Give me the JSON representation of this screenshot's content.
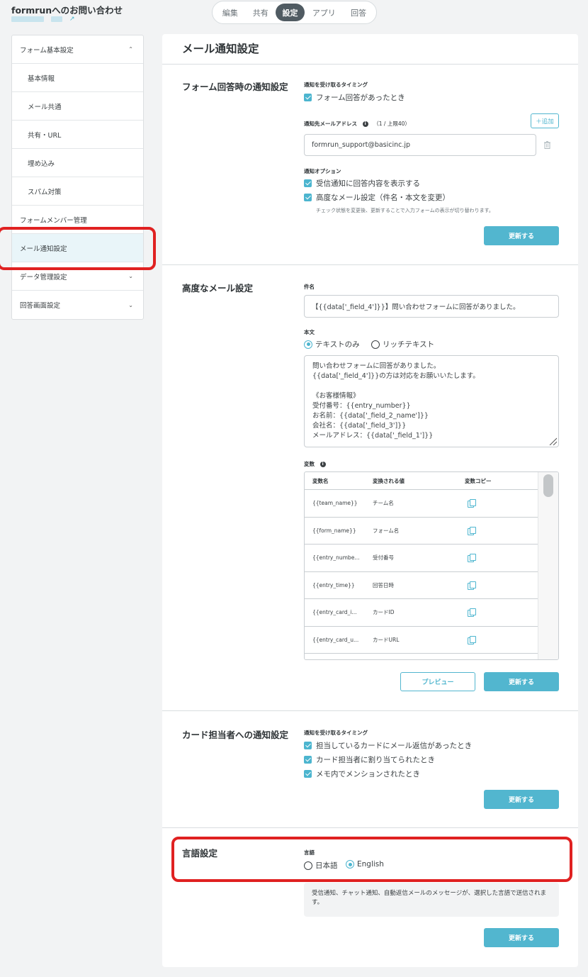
{
  "header": {
    "form_title": "formrunへのお問い合わせ"
  },
  "tabs": [
    "編集",
    "共有",
    "設定",
    "アプリ",
    "回答"
  ],
  "tabs_active": "設定",
  "sidebar": {
    "items": [
      {
        "label": "フォーム基本設定",
        "chevron": "⌃"
      },
      {
        "label": "基本情報"
      },
      {
        "label": "メール共通"
      },
      {
        "label": "共有・URL"
      },
      {
        "label": "埋め込み"
      },
      {
        "label": "スパム対策"
      },
      {
        "label": "フォームメンバー管理"
      },
      {
        "label": "メール通知設定"
      },
      {
        "label": "データ管理設定",
        "chevron": "⌄"
      },
      {
        "label": "回答画面設定",
        "chevron": "⌄"
      }
    ]
  },
  "main": {
    "page_title": "メール通知設定",
    "section1": {
      "title": "フォーム回答時の通知設定",
      "timing_label": "通知を受け取るタイミング",
      "timing_option": "フォーム回答があったとき",
      "address_label": "通知先メールアドレス",
      "address_limit": "（1 / 上限40）",
      "add_button": "＋追加",
      "email_value": "formrun_support@basicinc.jp",
      "options_label": "通知オプション",
      "option1": "受信通知に回答内容を表示する",
      "option2": "高度なメール設定（件名・本文を変更）",
      "hint": "チェック状態を変更後、更新することで入力フォームの表示が切り替わります。",
      "update_button": "更新する"
    },
    "section2": {
      "title": "高度なメール設定",
      "subject_label": "件名",
      "subject_value": "【{{data['_field_4']}}】問い合わせフォームに回答がありました。",
      "body_label": "本文",
      "radio_text": "テキストのみ",
      "radio_rich": "リッチテキスト",
      "body_lines": [
        "問い合わせフォームに回答がありました。",
        "{{data['_field_4']}}の方は対応をお願いいたします。",
        "",
        "《お客様情報》",
        "受付番号：{{entry_number}}",
        "お名前：{{data['_field_2_name']}}",
        "会社名：{{data['_field_3']}}",
        "メールアドレス：{{data['_field_1']}}"
      ],
      "vars_label": "変数",
      "table_headers": [
        "変数名",
        "変換される値",
        "変数コピー"
      ],
      "table_rows": [
        {
          "name": "{{team_name}}",
          "value": "チーム名"
        },
        {
          "name": "{{form_name}}",
          "value": "フォーム名"
        },
        {
          "name": "{{entry_numbe...",
          "value": "受付番号"
        },
        {
          "name": "{{entry_time}}",
          "value": "回答日時"
        },
        {
          "name": "{{entry_card_i...",
          "value": "カードID"
        },
        {
          "name": "{{entry_card_u...",
          "value": "カードURL"
        }
      ],
      "preview_button": "プレビュー",
      "update_button": "更新する"
    },
    "section3": {
      "title": "カード担当者への通知設定",
      "timing_label": "通知を受け取るタイミング",
      "option1": "担当しているカードにメール返信があったとき",
      "option2": "カード担当者に割り当てられたとき",
      "option3": "メモ内でメンションされたとき",
      "update_button": "更新する"
    },
    "section4": {
      "title": "言語設定",
      "lang_label": "言語",
      "lang_ja": "日本語",
      "lang_en": "English",
      "note": "受信通知、チャット通知、自動返信メールのメッセージが、選択した言語で送信されます。",
      "update_button": "更新する"
    }
  },
  "colors": {
    "accent": "#52b6cf",
    "highlight": "#e02121",
    "tab_active": "#505b62"
  }
}
